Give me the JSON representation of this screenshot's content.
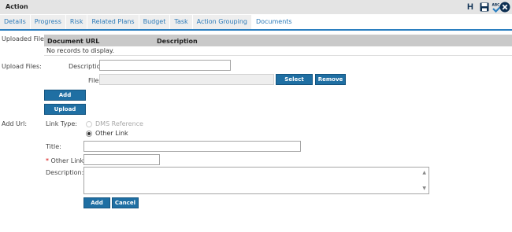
{
  "window": {
    "title": "Action"
  },
  "toolbar": {
    "icons": [
      "h-icon",
      "save-icon",
      "spellcheck-icon",
      "close-icon"
    ],
    "h_label": "H",
    "spell_label": "ABC"
  },
  "tabs": [
    {
      "label": "Details"
    },
    {
      "label": "Progress"
    },
    {
      "label": "Risk"
    },
    {
      "label": "Related Plans"
    },
    {
      "label": "Budget"
    },
    {
      "label": "Task"
    },
    {
      "label": "Action Grouping"
    },
    {
      "label": "Documents",
      "active": true
    }
  ],
  "uploaded_files": {
    "label": "Uploaded Files:",
    "columns": [
      "Document URL",
      "Description"
    ],
    "empty_text": "No records to display."
  },
  "upload_files": {
    "label": "Upload Files:",
    "description_label": "Description:",
    "description_value": "",
    "file_label": "File:",
    "file_value": "",
    "select_button": "Select",
    "remove_button": "Remove",
    "add_button": "Add",
    "upload_button": "Upload"
  },
  "add_url": {
    "label": "Add Url:",
    "link_type_label": "Link Type:",
    "options": [
      {
        "label": "DMS Reference",
        "selected": false,
        "disabled": true
      },
      {
        "label": "Other Link",
        "selected": true,
        "disabled": false
      }
    ],
    "title_label": "Title:",
    "title_value": "",
    "other_link_required": "*",
    "other_link_label": "Other Link:",
    "other_link_value": "",
    "description_label": "Description:",
    "description_value": "",
    "add_button": "Add",
    "cancel_button": "Cancel"
  },
  "colors": {
    "accent": "#1f6fa3",
    "tab_text": "#2a79b8",
    "tab_underline": "#2b7fc0",
    "title_bar": "#e4e4e4",
    "grid_header": "#c9c9c9",
    "required": "#d40000"
  }
}
